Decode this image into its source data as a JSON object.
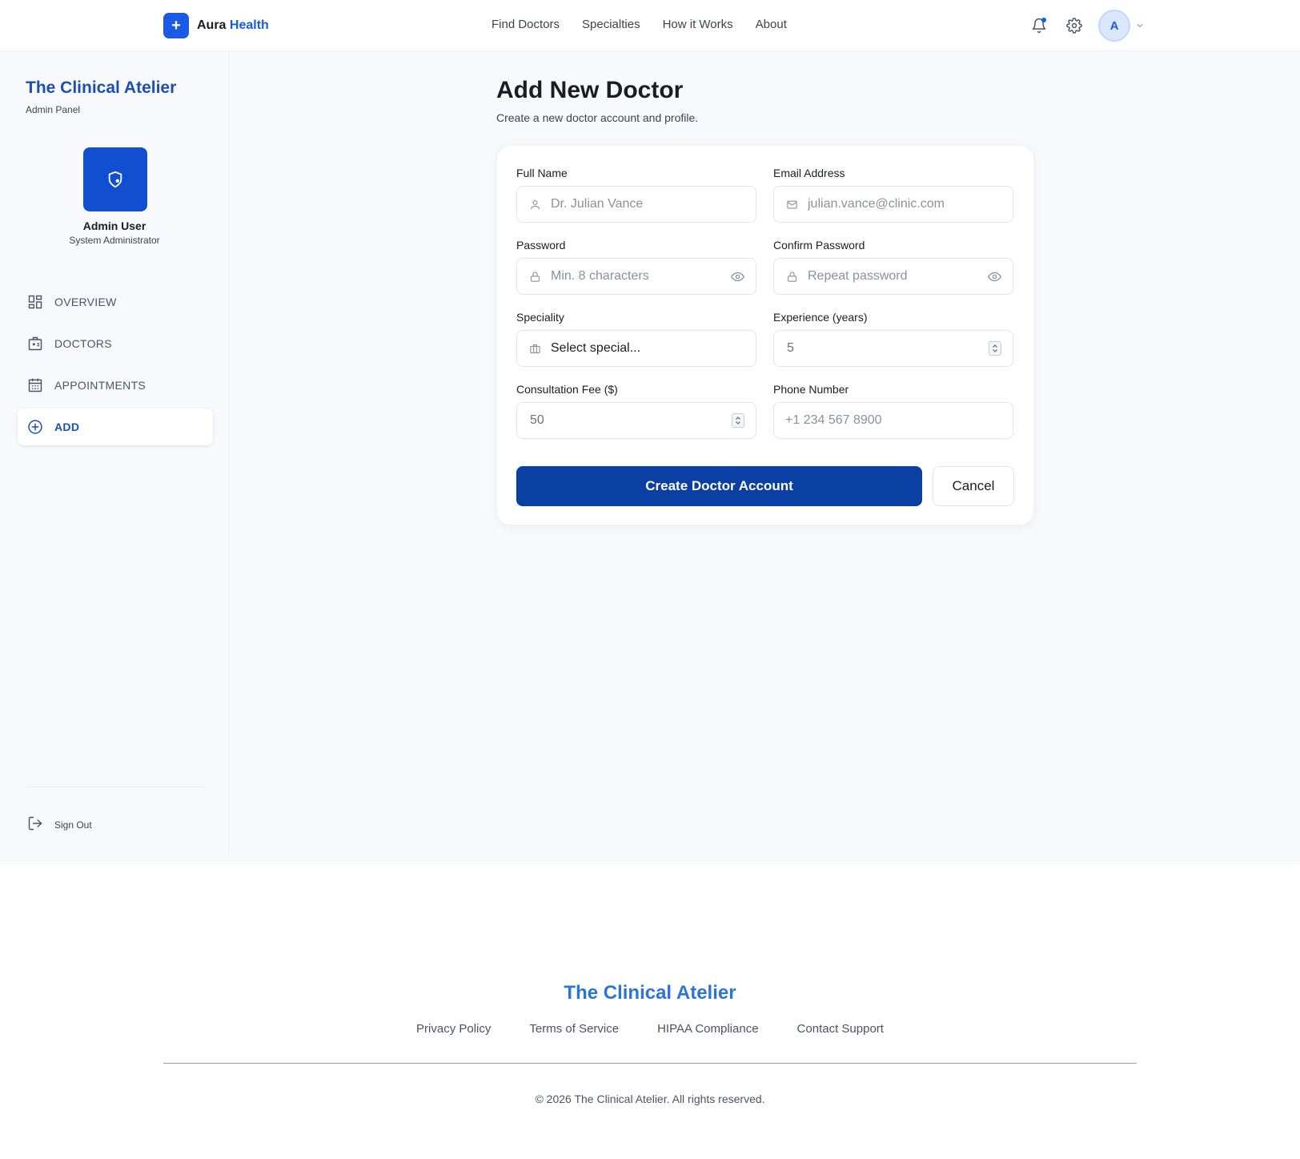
{
  "colors": {
    "brand": "#1a5ae6",
    "sidebar_title": "#1a4fb8",
    "primary_button": "#0a3fa3",
    "footer_title": "#2b74d8"
  },
  "header": {
    "logo_icon": "plus-icon",
    "brand_main": "Aura ",
    "brand_accent": "Health",
    "links": [
      "Find Doctors",
      "Specialties",
      "How it Works",
      "About"
    ],
    "icons": [
      "bell-icon",
      "gear-icon",
      "chevron-down-icon"
    ],
    "avatar_initial": "A"
  },
  "sidebar": {
    "title": "The Clinical Atelier",
    "subtitle": "Admin Panel",
    "avatar_icon": "shield-user-icon",
    "user_name": "Admin User",
    "user_role": "System Administrator",
    "items": [
      {
        "label": "OVERVIEW",
        "icon": "dashboard-icon",
        "active": false
      },
      {
        "label": "DOCTORS",
        "icon": "medical-id-icon",
        "active": false
      },
      {
        "label": "APPOINTMENTS",
        "icon": "calendar-icon",
        "active": false
      },
      {
        "label": "ADD",
        "icon": "plus-circle-icon",
        "active": true
      }
    ],
    "sign_out": "Sign Out"
  },
  "page": {
    "title": "Add New Doctor",
    "subtitle": "Create a new doctor account and profile."
  },
  "form": {
    "full_name": {
      "label": "Full Name",
      "placeholder": "Dr. Julian Vance",
      "icon": "user-icon"
    },
    "email": {
      "label": "Email Address",
      "placeholder": "julian.vance@clinic.com",
      "icon": "mail-icon"
    },
    "password": {
      "label": "Password",
      "placeholder": "Min. 8 characters",
      "icon": "lock-icon"
    },
    "confirm_password": {
      "label": "Confirm Password",
      "placeholder": "Repeat password",
      "icon": "lock-icon"
    },
    "speciality": {
      "label": "Speciality",
      "value": "Select special...",
      "icon": "briefcase-icon"
    },
    "experience": {
      "label": "Experience (years)",
      "value": "5"
    },
    "fee": {
      "label": "Consultation Fee ($)",
      "value": "50"
    },
    "phone": {
      "label": "Phone Number",
      "placeholder": "+1 234 567 8900"
    },
    "submit_label": "Create Doctor Account",
    "cancel_label": "Cancel"
  },
  "footer": {
    "title": "The Clinical Atelier",
    "links": [
      "Privacy Policy",
      "Terms of Service",
      "HIPAA Compliance",
      "Contact Support"
    ],
    "copyright": "© 2026 The Clinical Atelier. All rights reserved."
  }
}
